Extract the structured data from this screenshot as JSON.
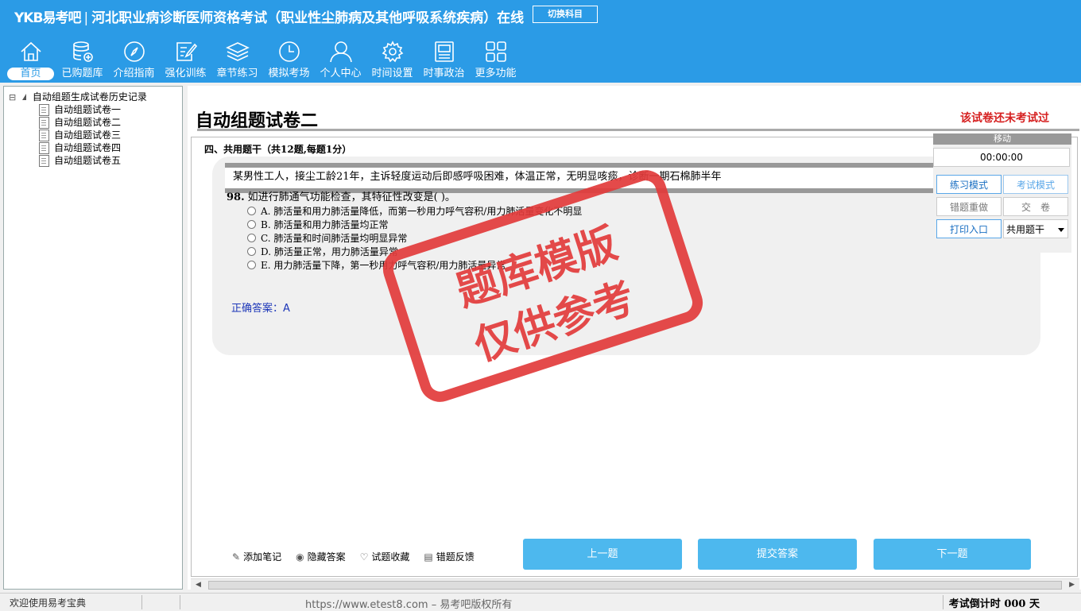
{
  "header": {
    "logo": "YKB易考吧",
    "separator": "|",
    "exam_title": "河北职业病诊断医师资格考试（职业性尘肺病及其他呼吸系统疾病）在线",
    "switch_label": "切换科目",
    "nav": [
      {
        "label": "首页",
        "icon": "home-icon"
      },
      {
        "label": "已购题库",
        "icon": "database-icon"
      },
      {
        "label": "介绍指南",
        "icon": "compass-icon"
      },
      {
        "label": "强化训练",
        "icon": "edit-icon"
      },
      {
        "label": "章节练习",
        "icon": "layers-icon"
      },
      {
        "label": "模拟考场",
        "icon": "clock-icon"
      },
      {
        "label": "个人中心",
        "icon": "user-icon"
      },
      {
        "label": "时间设置",
        "icon": "gear-icon"
      },
      {
        "label": "时事政治",
        "icon": "news-icon"
      },
      {
        "label": "更多功能",
        "icon": "grid-icon"
      }
    ]
  },
  "tree": {
    "toggle": "⊟",
    "root": "自动组题生成试卷历史记录",
    "items": [
      "自动组题试卷一",
      "自动组题试卷二",
      "自动组题试卷三",
      "自动组题试卷四",
      "自动组题试卷五"
    ]
  },
  "paper": {
    "title": "自动组题试卷二",
    "status": "该试卷还未考试过",
    "section": "四、共用题干（共12题,每题1分）",
    "stem": "某男性工人，接尘工龄21年，主诉轻度运动后即感呼吸困难，体温正常，无明显咳痰，诊断一期石棉肺半年",
    "question_no": "98.",
    "question": "如进行肺通气功能检查，其特征性改变是( )。",
    "options": [
      "A. 肺活量和用力肺活量降低，而第一秒用力呼气容积/用力肺活量变化不明显",
      "B. 肺活量和用力肺活量均正常",
      "C. 肺活量和时间肺活量均明显异常",
      "D. 肺活量正常，用力肺活量异常",
      "E. 用力肺活量下降，第一秒用力呼气容积/用力肺活量异常"
    ],
    "answer_label": "正确答案：",
    "answer_value": "A"
  },
  "stamp": {
    "line1": "题库模版",
    "line2": "仅供参考",
    "color": "#e23b3b"
  },
  "panel": {
    "move": "移动",
    "timer": "00:00:00",
    "practice_mode": "练习模式",
    "exam_mode": "考试模式",
    "redo_wrong": "错题重做",
    "submit_paper": "交　卷",
    "print": "打印入口",
    "type_select": "共用题干"
  },
  "tools": {
    "note": "添加笔记",
    "hide": "隐藏答案",
    "fav": "试题收藏",
    "feedback": "错题反馈"
  },
  "buttons": {
    "prev": "上一题",
    "submit": "提交答案",
    "next": "下一题"
  },
  "status": {
    "welcome": "欢迎使用易考宝典",
    "copyright": "https://www.etest8.com – 易考吧版权所有",
    "countdown": "考试倒计时 000 天"
  },
  "colors": {
    "header": "#2b9be6",
    "accent_button": "#4db8ee",
    "warning": "#d62020",
    "answer": "#1c36b8"
  }
}
